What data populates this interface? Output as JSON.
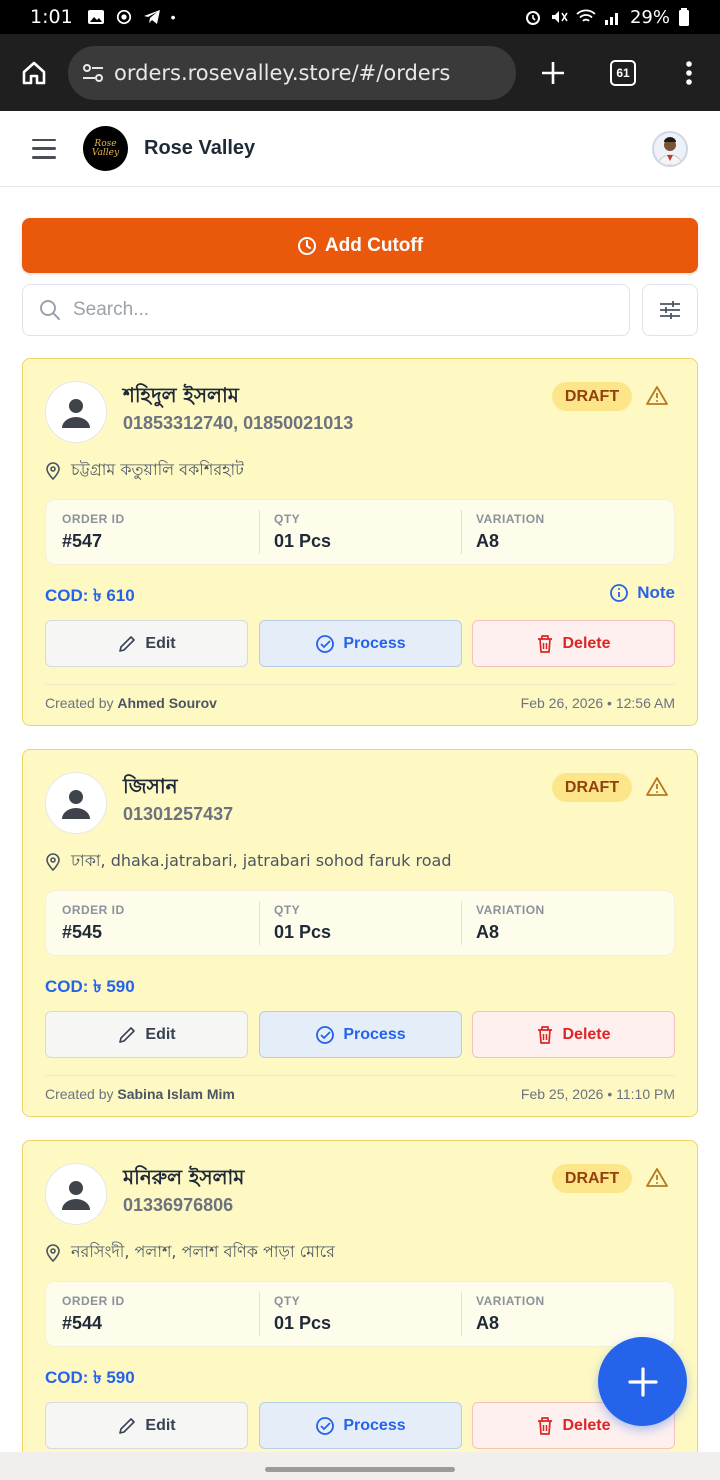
{
  "status_bar": {
    "time": "1:01",
    "battery": "29%"
  },
  "browser": {
    "url": "orders.rosevalley.store/#/orders",
    "tab_count": "61"
  },
  "header": {
    "brand": "Rose Valley",
    "logo_text": "Rose Valley"
  },
  "toolbar": {
    "cutoff_label": "Add Cutoff",
    "search_placeholder": "Search..."
  },
  "labels": {
    "order_id": "ORDER ID",
    "qty": "QTY",
    "variation": "VARIATION",
    "note": "Note",
    "edit": "Edit",
    "process": "Process",
    "delete": "Delete",
    "created_by": "Created by"
  },
  "orders": [
    {
      "name": "শহিদুল ইসলাম",
      "phone": "01853312740, 01850021013",
      "status": "DRAFT",
      "address": "চট্টগ্রাম কতুয়ালি বকশিরহাট",
      "order_id": "#547",
      "qty": "01 Pcs",
      "variation": "A8",
      "cod": "COD: ৳ 610",
      "has_note": true,
      "creator": "Ahmed Sourov",
      "date": "Feb 26, 2026 • 12:56 AM"
    },
    {
      "name": "জিসান",
      "phone": "01301257437",
      "status": "DRAFT",
      "address": "ঢাকা, dhaka.jatrabari, jatrabari sohod faruk road",
      "order_id": "#545",
      "qty": "01 Pcs",
      "variation": "A8",
      "cod": "COD: ৳ 590",
      "has_note": false,
      "creator": "Sabina Islam Mim",
      "date": "Feb 25, 2026 • 11:10 PM"
    },
    {
      "name": "মনিরুল ইসলাম",
      "phone": "01336976806",
      "status": "DRAFT",
      "address": "নরসিংদী, পলাশ, পলাশ বণিক পাড়া মোরে",
      "order_id": "#544",
      "qty": "01 Pcs",
      "variation": "A8",
      "cod": "COD: ৳ 590",
      "has_note": false,
      "creator": "",
      "date": ""
    }
  ],
  "colors": {
    "accent_orange": "#ea580c",
    "primary_blue": "#2563eb",
    "card_bg": "#fef9c3",
    "draft_badge": "#fde68a",
    "danger_red": "#dc2626"
  }
}
